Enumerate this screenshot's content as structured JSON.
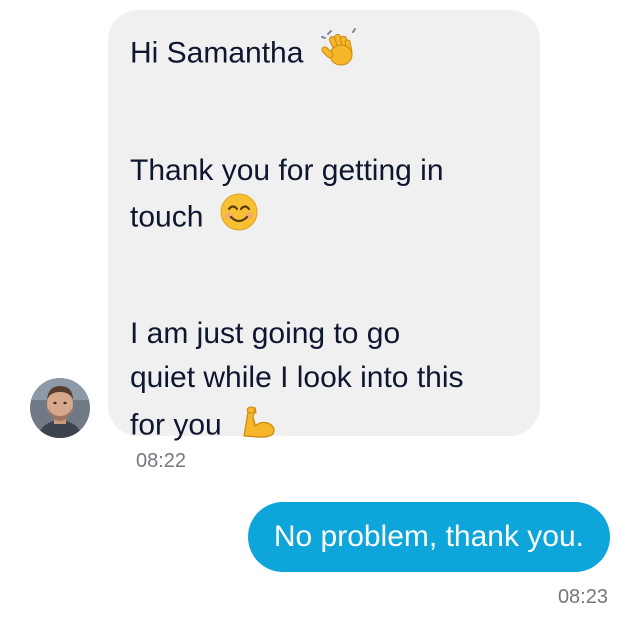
{
  "conversation": {
    "incoming": {
      "greeting": "Hi Samantha",
      "greeting_emoji": "waving-hand-icon",
      "thanks_line1": "Thank you for getting in",
      "thanks_line2": "touch",
      "thanks_emoji": "smiling-face-icon",
      "wait_line1": "I am just going to go",
      "wait_line2": "quiet while I look into this",
      "wait_line3": "for you",
      "wait_emoji": "flexed-biceps-icon",
      "time": "08:22"
    },
    "outgoing": {
      "text": "No problem, thank you.",
      "time": "08:23"
    }
  },
  "colors": {
    "incoming_bubble": "#f0f0f1",
    "outgoing_bubble": "#0da5da",
    "incoming_text": "#0e1630",
    "timestamp": "#75777e"
  }
}
